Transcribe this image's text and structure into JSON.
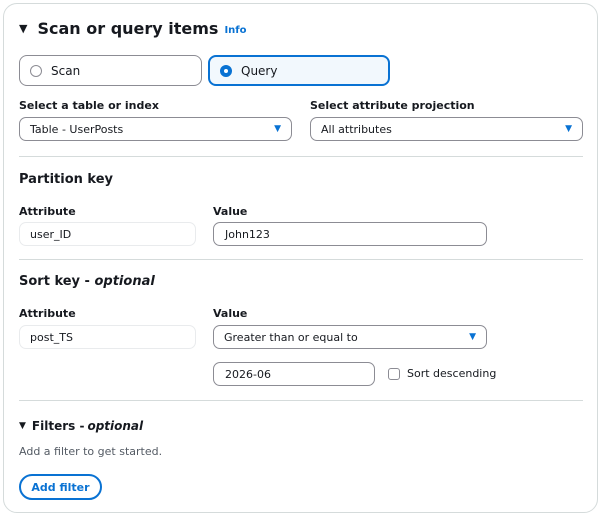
{
  "header": {
    "title": "Scan or query items",
    "info_label": "Info"
  },
  "mode": {
    "options": [
      {
        "label": "Scan",
        "selected": false
      },
      {
        "label": "Query",
        "selected": true
      }
    ]
  },
  "table_select": {
    "label": "Select a table or index",
    "value": "Table - UserPosts"
  },
  "projection_select": {
    "label": "Select attribute projection",
    "value": "All attributes"
  },
  "partition_key": {
    "heading": "Partition key",
    "attribute_label": "Attribute",
    "attribute_value": "user_ID",
    "value_label": "Value",
    "value": "John123"
  },
  "sort_key": {
    "heading": "Sort key - ",
    "heading_optional": "optional",
    "attribute_label": "Attribute",
    "attribute_value": "post_TS",
    "value_label": "Value",
    "condition": "Greater than or equal to",
    "value": "2026-06",
    "sort_descending_label": "Sort descending",
    "sort_descending_checked": false
  },
  "filters": {
    "heading": "Filters - ",
    "heading_optional": "optional",
    "hint": "Add a filter to get started.",
    "add_button": "Add filter"
  },
  "colors": {
    "accent": "#0972d3",
    "border": "#8c8c94",
    "divider": "#d5dbdb"
  }
}
